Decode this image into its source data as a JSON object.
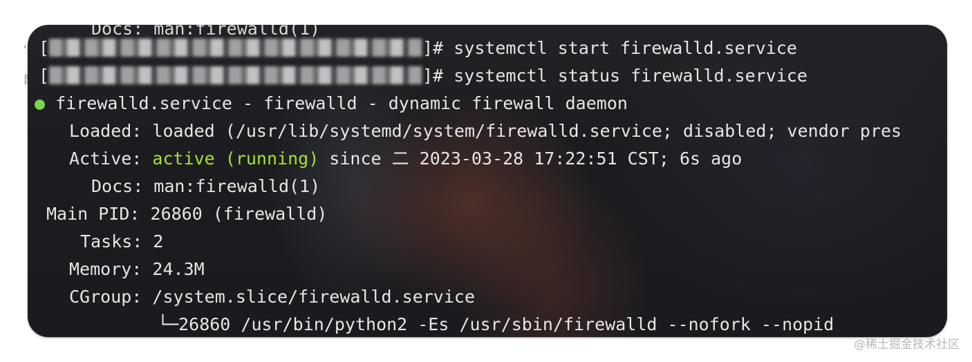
{
  "terminal": {
    "partial_top_line": "Docs: man:firewalld(1)",
    "prompt_open": "[",
    "prompt_close": "]#",
    "cmd1": " systemctl start firewalld.service",
    "cmd2": " systemctl status firewalld.service",
    "status_dot": "●",
    "unit_line": " firewalld.service - firewalld - dynamic firewall daemon",
    "loaded_label": "Loaded:",
    "loaded_value": "loaded (/usr/lib/systemd/system/firewalld.service; disabled; vendor pres",
    "active_label": "Active:",
    "active_state": "active (running)",
    "active_rest": " since 二 2023-03-28 17:22:51 CST; 6s ago",
    "docs_label": "Docs:",
    "docs_value": "man:firewalld(1)",
    "pid_label": "Main PID:",
    "pid_value": "26860 (firewalld)",
    "tasks_label": "Tasks:",
    "tasks_value": "2",
    "memory_label": "Memory:",
    "memory_value": "24.3M",
    "cgroup_label": "CGroup:",
    "cgroup_value": "/system.slice/firewalld.service",
    "cgroup_proc": "└─26860 /usr/bin/python2 -Es /usr/sbin/firewalld --nofork --nopid"
  },
  "watermark": "@稀土掘金技术社区",
  "colors": {
    "active_green": "#a6e22e",
    "dot_green": "#7bd64b",
    "terminal_bg": "#1c1c20",
    "text": "#e6e6e6"
  }
}
